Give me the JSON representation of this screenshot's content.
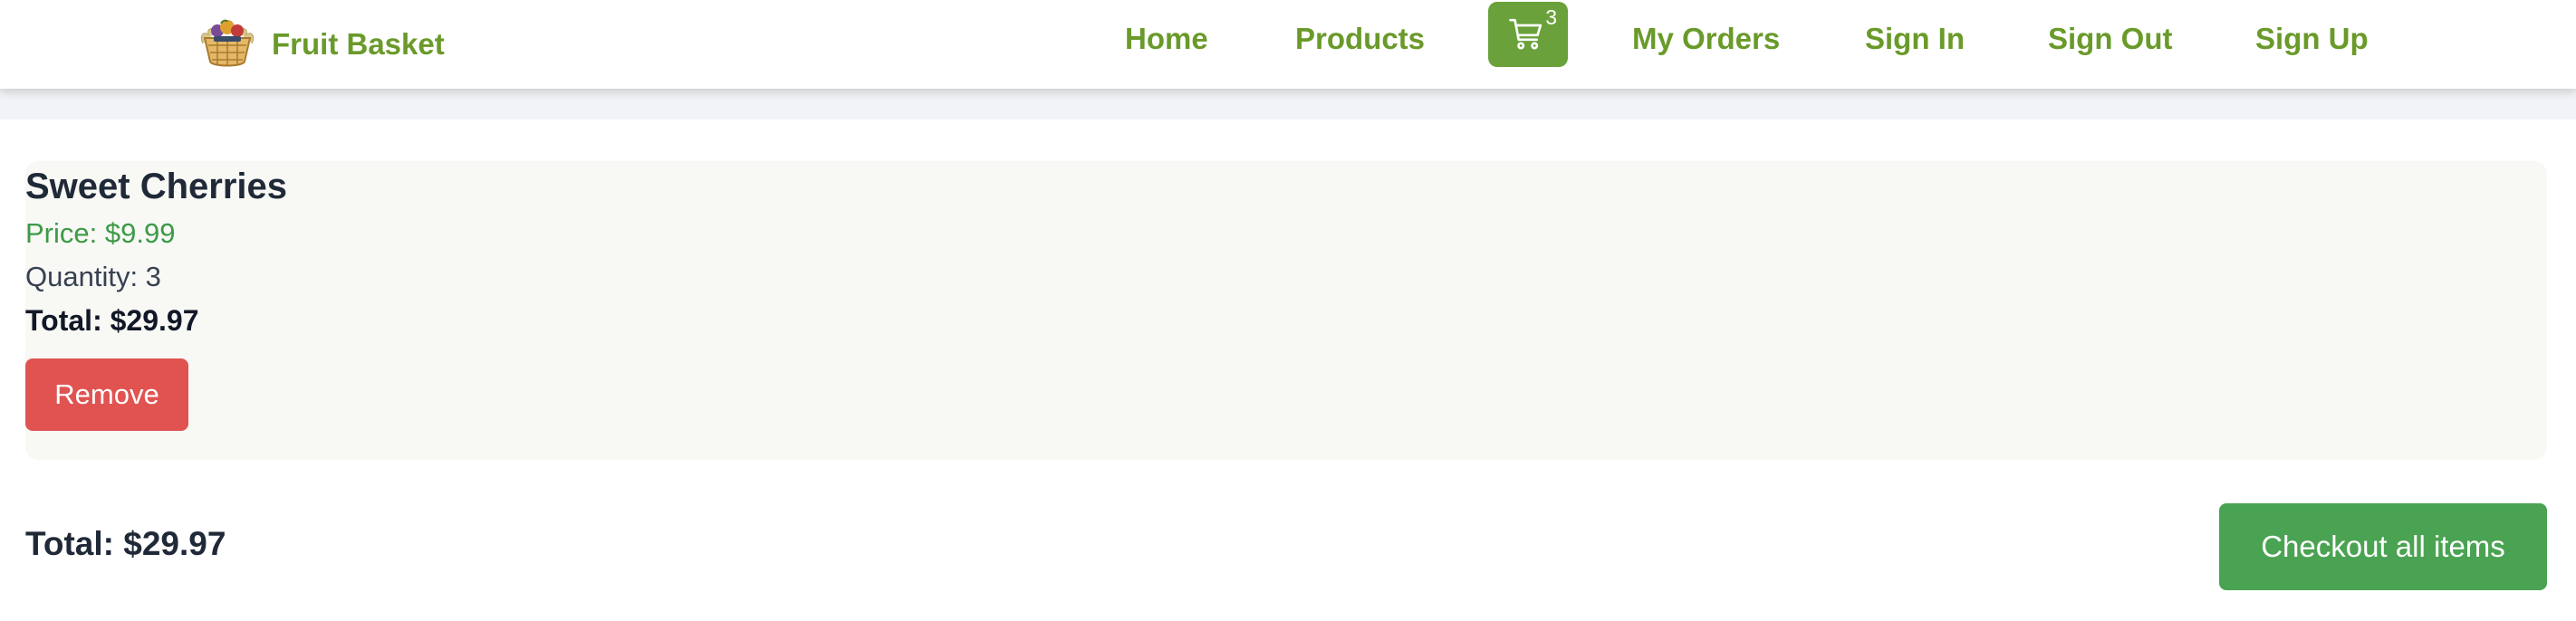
{
  "header": {
    "brand_name": "Fruit Basket",
    "brand_logo_icon": "fruit-basket-logo-icon",
    "nav": {
      "home": "Home",
      "products": "Products",
      "my_orders": "My Orders",
      "sign_in": "Sign In",
      "sign_out": "Sign Out",
      "sign_up": "Sign Up"
    },
    "cart": {
      "icon": "shopping-cart-icon",
      "count": "3"
    }
  },
  "cart_items": [
    {
      "name": "Sweet Cherries",
      "price": "Price: $9.99",
      "quantity": "Quantity: 3",
      "total": "Total: $29.97",
      "remove_label": "Remove"
    }
  ],
  "summary": {
    "total": "Total: $29.97",
    "checkout_label": "Checkout all items"
  },
  "colors": {
    "brand_green": "#6a9a2a",
    "cart_button": "#6aa13a",
    "price_green": "#3d9a47",
    "remove_red": "#e05351",
    "checkout_green": "#4aa352",
    "card_background": "#f8f8f5"
  }
}
